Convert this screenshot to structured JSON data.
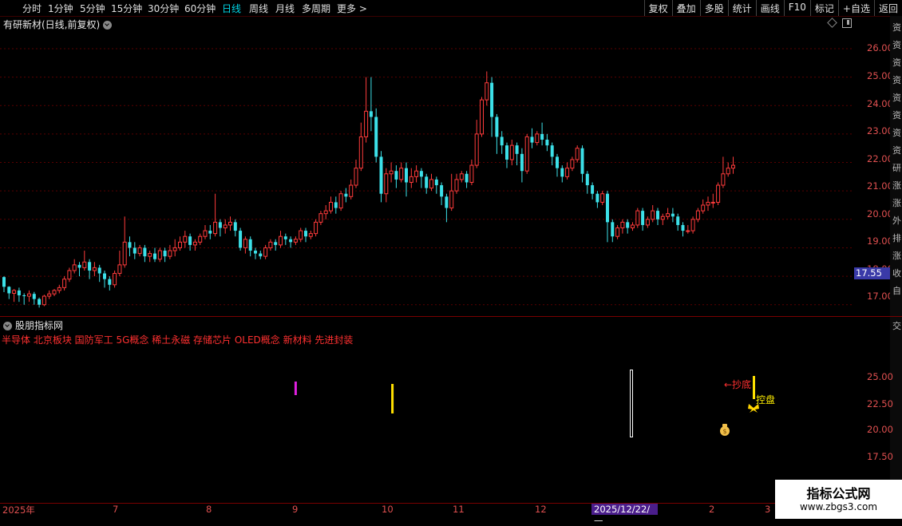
{
  "toolbar": {
    "periods": [
      "分时",
      "1分钟",
      "5分钟",
      "15分钟",
      "30分钟",
      "60分钟",
      "日线",
      "周线",
      "月线",
      "多周期",
      "更多 >"
    ],
    "active_period": "日线",
    "buttons": [
      "复权",
      "叠加",
      "多股",
      "统计",
      "画线",
      "F10",
      "标记",
      "+自选",
      "返回"
    ]
  },
  "main_chart": {
    "title": "有研新材(日线,前复权)",
    "y_ticks": [
      "26.00",
      "25.00",
      "24.00",
      "23.00",
      "22.00",
      "21.00",
      "20.00",
      "19.00",
      "18.00",
      "17.00"
    ],
    "last_price": "17.55",
    "grid_color": "#5a0000",
    "up_color": "#ff3b3b",
    "down_color": "#3ce0e8"
  },
  "indicator": {
    "title": "股朋指标网",
    "concepts": "半导体 北京板块 国防军工 5G概念 稀土永磁 存储芯片 OLED概念 新材料 先进封装",
    "y_ticks": [
      "25.00",
      "22.50",
      "20.00",
      "17.50"
    ],
    "label_bottom": "←抄底",
    "label_control": "控盘"
  },
  "date_axis": {
    "labels": [
      "2025年",
      "7",
      "8",
      "9",
      "10",
      "11",
      "12",
      "2",
      "3"
    ],
    "cursor_date": "2025/12/22/—"
  },
  "sidebar_chars": [
    "资",
    "资",
    "资",
    "资",
    "资",
    "资",
    "资",
    "资",
    "研",
    "涨",
    "涨",
    "外",
    "排",
    "涨",
    "收",
    "自",
    "交"
  ],
  "watermark": {
    "line1": "指标公式网",
    "line2": "www.zbgs3.com"
  },
  "chart_data": {
    "type": "candlestick",
    "ylim": [
      16.6,
      26.7
    ],
    "days": 168,
    "ohlc": [
      [
        17.97,
        17.63,
        17.44,
        18.0
      ],
      [
        17.63,
        17.4,
        17.2,
        17.65
      ],
      [
        17.4,
        17.5,
        17.1,
        17.55
      ],
      [
        17.5,
        17.33,
        17.1,
        17.6
      ],
      [
        17.33,
        17.3,
        17.0,
        17.4
      ],
      [
        17.3,
        17.38,
        17.1,
        17.5
      ],
      [
        17.38,
        17.2,
        17.0,
        17.45
      ],
      [
        17.2,
        17.0,
        16.9,
        17.25
      ],
      [
        17.0,
        17.3,
        16.95,
        17.35
      ],
      [
        17.3,
        17.38,
        17.2,
        17.5
      ],
      [
        17.38,
        17.5,
        17.3,
        17.55
      ],
      [
        17.5,
        17.6,
        17.4,
        17.7
      ],
      [
        17.6,
        17.9,
        17.5,
        18.0
      ],
      [
        17.9,
        18.2,
        17.8,
        18.3
      ],
      [
        18.2,
        18.4,
        18.1,
        18.6
      ],
      [
        18.4,
        18.3,
        18.0,
        18.5
      ],
      [
        18.3,
        18.5,
        18.2,
        18.9
      ],
      [
        18.5,
        18.2,
        17.9,
        18.6
      ],
      [
        18.2,
        18.3,
        18.0,
        18.5
      ],
      [
        18.3,
        18.1,
        17.8,
        18.4
      ],
      [
        18.1,
        17.9,
        17.6,
        18.2
      ],
      [
        17.9,
        17.7,
        17.5,
        18.0
      ],
      [
        17.7,
        18.1,
        17.6,
        18.2
      ],
      [
        18.1,
        18.4,
        18.0,
        18.9
      ],
      [
        18.4,
        19.2,
        18.3,
        20.1
      ],
      [
        19.2,
        19.0,
        18.7,
        19.4
      ],
      [
        19.0,
        18.8,
        18.6,
        19.2
      ],
      [
        18.8,
        19.0,
        18.7,
        19.1
      ],
      [
        19.0,
        18.7,
        18.5,
        19.1
      ],
      [
        18.7,
        18.8,
        18.5,
        18.9
      ],
      [
        18.8,
        18.6,
        18.5,
        19.0
      ],
      [
        18.6,
        18.9,
        18.5,
        19.0
      ],
      [
        18.9,
        18.7,
        18.5,
        19.0
      ],
      [
        18.7,
        18.9,
        18.6,
        19.1
      ],
      [
        18.9,
        19.0,
        18.7,
        19.3
      ],
      [
        19.0,
        19.2,
        18.9,
        19.4
      ],
      [
        19.2,
        19.4,
        19.0,
        19.6
      ],
      [
        19.4,
        19.1,
        18.9,
        19.5
      ],
      [
        19.1,
        19.2,
        18.9,
        19.3
      ],
      [
        19.2,
        19.4,
        19.1,
        19.5
      ],
      [
        19.4,
        19.6,
        19.3,
        19.8
      ],
      [
        19.6,
        19.5,
        19.3,
        19.8
      ],
      [
        19.5,
        19.9,
        19.4,
        20.9
      ],
      [
        19.9,
        19.7,
        19.4,
        20.0
      ],
      [
        19.7,
        19.8,
        19.5,
        20.0
      ],
      [
        19.8,
        19.9,
        19.6,
        20.1
      ],
      [
        19.9,
        19.6,
        19.4,
        20.0
      ],
      [
        19.6,
        19.0,
        18.9,
        19.7
      ],
      [
        19.0,
        19.3,
        18.8,
        19.4
      ],
      [
        19.3,
        18.9,
        18.7,
        19.4
      ],
      [
        18.9,
        18.8,
        18.6,
        19.0
      ],
      [
        18.8,
        18.7,
        18.6,
        18.9
      ],
      [
        18.7,
        19.0,
        18.6,
        19.1
      ],
      [
        19.0,
        19.2,
        18.9,
        19.3
      ],
      [
        19.2,
        19.1,
        18.9,
        19.3
      ],
      [
        19.1,
        19.4,
        19.0,
        19.6
      ],
      [
        19.4,
        19.3,
        19.1,
        19.5
      ],
      [
        19.3,
        19.2,
        19.0,
        19.4
      ],
      [
        19.2,
        19.3,
        19.1,
        19.4
      ],
      [
        19.3,
        19.6,
        19.2,
        19.7
      ],
      [
        19.6,
        19.4,
        19.2,
        19.7
      ],
      [
        19.4,
        19.5,
        19.3,
        19.6
      ],
      [
        19.5,
        19.9,
        19.4,
        20.0
      ],
      [
        19.9,
        20.2,
        19.8,
        20.3
      ],
      [
        20.2,
        20.3,
        20.0,
        20.5
      ],
      [
        20.3,
        20.6,
        20.2,
        20.8
      ],
      [
        20.6,
        20.4,
        20.2,
        20.8
      ],
      [
        20.4,
        20.9,
        20.3,
        21.0
      ],
      [
        20.9,
        20.8,
        20.6,
        21.1
      ],
      [
        20.8,
        21.2,
        20.7,
        21.4
      ],
      [
        21.2,
        21.8,
        21.1,
        22.1
      ],
      [
        21.8,
        22.9,
        21.7,
        23.4
      ],
      [
        22.9,
        23.8,
        22.7,
        25.0
      ],
      [
        23.8,
        23.6,
        23.1,
        25.0
      ],
      [
        23.6,
        22.2,
        22.0,
        23.9
      ],
      [
        22.2,
        20.9,
        20.6,
        22.4
      ],
      [
        20.9,
        21.6,
        20.6,
        21.8
      ],
      [
        21.6,
        21.7,
        21.3,
        22.0
      ],
      [
        21.7,
        21.4,
        21.1,
        21.9
      ],
      [
        21.4,
        21.8,
        21.3,
        22.0
      ],
      [
        21.8,
        21.3,
        20.8,
        22.0
      ],
      [
        21.3,
        21.5,
        21.1,
        21.8
      ],
      [
        21.5,
        21.7,
        21.3,
        21.9
      ],
      [
        21.7,
        21.5,
        21.1,
        21.8
      ],
      [
        21.5,
        21.1,
        20.9,
        21.6
      ],
      [
        21.1,
        21.4,
        21.0,
        21.6
      ],
      [
        21.4,
        21.2,
        20.9,
        21.5
      ],
      [
        21.2,
        20.8,
        20.5,
        21.3
      ],
      [
        20.8,
        20.4,
        19.9,
        20.9
      ],
      [
        20.4,
        21.0,
        20.3,
        21.6
      ],
      [
        21.0,
        21.4,
        20.9,
        21.6
      ],
      [
        21.4,
        21.6,
        21.3,
        21.7
      ],
      [
        21.6,
        21.3,
        21.1,
        21.7
      ],
      [
        21.3,
        21.9,
        21.2,
        22.1
      ],
      [
        21.9,
        23.0,
        21.8,
        23.5
      ],
      [
        23.0,
        24.2,
        22.9,
        24.3
      ],
      [
        24.2,
        24.8,
        24.0,
        25.2
      ],
      [
        24.8,
        23.6,
        22.9,
        25.0
      ],
      [
        23.6,
        22.9,
        22.3,
        23.7
      ],
      [
        22.9,
        22.6,
        22.3,
        23.1
      ],
      [
        22.6,
        22.1,
        21.8,
        22.7
      ],
      [
        22.1,
        22.6,
        21.9,
        22.8
      ],
      [
        22.6,
        22.3,
        21.9,
        22.7
      ],
      [
        22.3,
        21.7,
        21.3,
        22.5
      ],
      [
        21.7,
        22.9,
        21.6,
        23.0
      ],
      [
        22.9,
        22.7,
        22.5,
        23.2
      ],
      [
        22.7,
        23.0,
        22.6,
        23.1
      ],
      [
        23.0,
        22.8,
        22.6,
        23.4
      ],
      [
        22.8,
        22.6,
        22.4,
        23.0
      ],
      [
        22.6,
        22.2,
        21.9,
        22.7
      ],
      [
        22.2,
        21.8,
        21.5,
        22.3
      ],
      [
        21.8,
        21.5,
        21.3,
        21.9
      ],
      [
        21.5,
        21.8,
        21.4,
        22.0
      ],
      [
        21.8,
        22.1,
        21.7,
        22.2
      ],
      [
        22.1,
        22.5,
        22.0,
        22.6
      ],
      [
        22.5,
        21.6,
        21.3,
        22.6
      ],
      [
        21.6,
        21.2,
        20.9,
        21.7
      ],
      [
        21.2,
        20.9,
        20.7,
        21.3
      ],
      [
        20.9,
        20.6,
        20.4,
        21.0
      ],
      [
        20.6,
        20.9,
        20.5,
        21.0
      ],
      [
        20.9,
        19.9,
        19.2,
        21.0
      ],
      [
        19.9,
        19.4,
        19.2,
        20.0
      ],
      [
        19.4,
        19.7,
        19.3,
        19.8
      ],
      [
        19.7,
        19.9,
        19.5,
        20.0
      ],
      [
        19.9,
        19.7,
        19.5,
        20.0
      ],
      [
        19.7,
        19.8,
        19.6,
        19.9
      ],
      [
        19.8,
        20.3,
        19.7,
        20.4
      ],
      [
        20.3,
        19.8,
        19.6,
        20.4
      ],
      [
        19.8,
        20.0,
        19.7,
        20.1
      ],
      [
        20.0,
        20.3,
        19.9,
        20.5
      ],
      [
        20.3,
        20.0,
        19.8,
        20.4
      ],
      [
        20.0,
        20.1,
        19.8,
        20.2
      ],
      [
        20.1,
        20.2,
        20.0,
        20.4
      ],
      [
        20.2,
        20.1,
        19.9,
        20.4
      ],
      [
        20.1,
        19.8,
        19.6,
        20.2
      ],
      [
        19.8,
        19.6,
        19.4,
        19.9
      ],
      [
        19.6,
        19.6,
        19.5,
        19.8
      ],
      [
        19.6,
        20.0,
        19.5,
        20.1
      ],
      [
        20.0,
        20.3,
        19.9,
        20.4
      ],
      [
        20.3,
        20.5,
        20.2,
        20.7
      ],
      [
        20.5,
        20.6,
        20.3,
        20.8
      ],
      [
        20.6,
        20.6,
        20.4,
        20.9
      ],
      [
        20.6,
        21.2,
        20.5,
        21.3
      ],
      [
        21.2,
        21.6,
        21.1,
        22.2
      ],
      [
        21.6,
        21.8,
        21.5,
        22.0
      ],
      [
        21.8,
        21.9,
        21.6,
        22.2
      ]
    ],
    "signals": [
      {
        "kind": "magenta-bar",
        "day": 73
      },
      {
        "kind": "yellow-bar",
        "day": 97
      },
      {
        "kind": "white-box",
        "day": 157
      }
    ]
  }
}
